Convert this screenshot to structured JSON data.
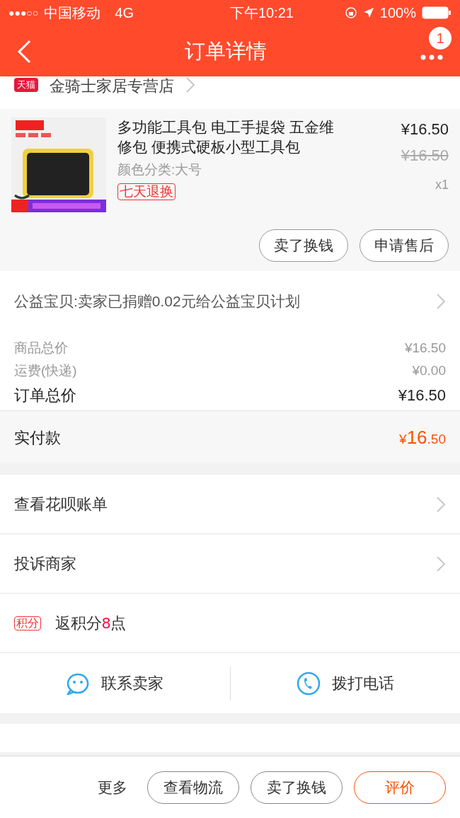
{
  "status_bar": {
    "signal": "●●●○○",
    "carrier": "中国移动",
    "network": "4G",
    "time": "下午10:21",
    "battery": "100%"
  },
  "nav": {
    "title": "订单详情",
    "badge": "1"
  },
  "shop": {
    "badge": "天猫",
    "name": "金骑士家居专营店"
  },
  "product": {
    "title": "多功能工具包 电工手提袋 五金维修包 便携式硬板小型工具包",
    "variant": "颜色分类:大号",
    "tag": "七天退换",
    "price": "¥16.50",
    "original_price": "¥16.50",
    "quantity": "x1",
    "buttons": [
      "卖了换钱",
      "申请售后"
    ]
  },
  "charity": {
    "text": "公益宝贝:卖家已捐赠0.02元给公益宝贝计划"
  },
  "summary": [
    {
      "label": "商品总价",
      "value": "¥16.50",
      "kind": "minor"
    },
    {
      "label": "运费(快递)",
      "value": "¥0.00",
      "kind": "minor"
    },
    {
      "label": "订单总价",
      "value": "¥16.50",
      "kind": "major"
    }
  ],
  "payment": {
    "label": "实付款",
    "currency": "¥",
    "integer": "16",
    "decimal": ".50"
  },
  "links": [
    {
      "label": "查看花呗账单"
    },
    {
      "label": "投诉商家"
    }
  ],
  "points": {
    "badge": "积分",
    "prefix": "返积分",
    "amount": "8",
    "suffix": "点"
  },
  "contact": [
    {
      "label": "联系卖家",
      "kind": "chat"
    },
    {
      "label": "拨打电话",
      "kind": "phone"
    }
  ],
  "bottom_bar": {
    "more": "更多",
    "buttons": [
      {
        "label": "查看物流",
        "primary": false
      },
      {
        "label": "卖了换钱",
        "primary": false
      },
      {
        "label": "评价",
        "primary": true
      }
    ]
  }
}
